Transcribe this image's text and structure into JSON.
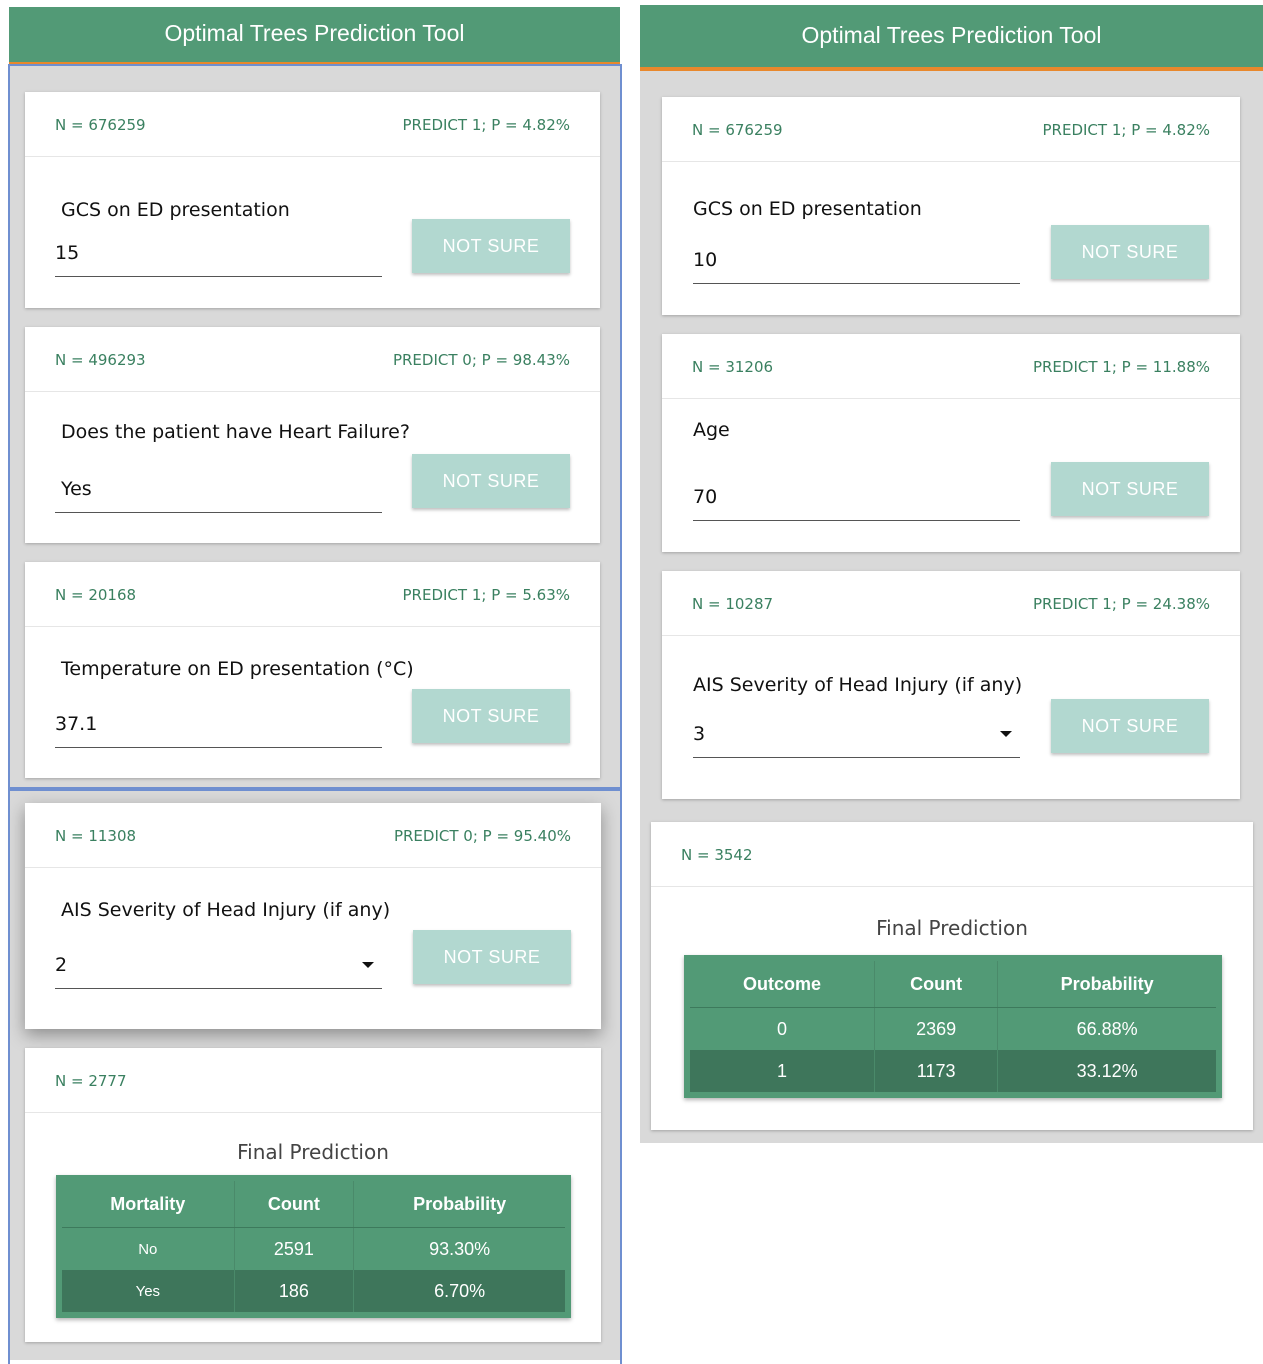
{
  "left": {
    "title": "Optimal Trees Prediction Tool",
    "cards": [
      {
        "n": "N = 676259",
        "predict": "PREDICT 1; P = 4.82%",
        "question": "GCS on ED presentation",
        "value": "15",
        "button": "NOT SURE"
      },
      {
        "n": "N = 496293",
        "predict": "PREDICT 0; P = 98.43%",
        "question": "Does the patient have Heart Failure?",
        "value": "Yes",
        "button": "NOT SURE"
      },
      {
        "n": "N = 20168",
        "predict": "PREDICT 1; P = 5.63%",
        "question": "Temperature on ED presentation (°C)",
        "value": "37.1",
        "button": "NOT SURE"
      },
      {
        "n": "N = 11308",
        "predict": "PREDICT 0; P = 95.40%",
        "question": "AIS Severity of Head Injury (if any)",
        "value": "2",
        "button": "NOT SURE"
      }
    ],
    "final": {
      "n": "N = 2777",
      "title": "Final Prediction",
      "headers": [
        "Mortality",
        "Count",
        "Probability"
      ],
      "rows": [
        [
          "No",
          "2591",
          "93.30%"
        ],
        [
          "Yes",
          "186",
          "6.70%"
        ]
      ]
    }
  },
  "right": {
    "title": "Optimal Trees Prediction Tool",
    "cards": [
      {
        "n": "N = 676259",
        "predict": "PREDICT 1; P = 4.82%",
        "question": "GCS on ED presentation",
        "value": "10",
        "button": "NOT SURE"
      },
      {
        "n": "N = 31206",
        "predict": "PREDICT 1; P = 11.88%",
        "question": "Age",
        "value": "70",
        "button": "NOT SURE"
      },
      {
        "n": "N = 10287",
        "predict": "PREDICT 1; P = 24.38%",
        "question": "AIS Severity of Head Injury (if any)",
        "value": "3",
        "button": "NOT SURE"
      }
    ],
    "final": {
      "n": "N = 3542",
      "title": "Final Prediction",
      "headers": [
        "Outcome",
        "Count",
        "Probability"
      ],
      "rows": [
        [
          "0",
          "2369",
          "66.88%"
        ],
        [
          "1",
          "1173",
          "33.12%"
        ]
      ]
    }
  },
  "colors": {
    "header": "#529a76",
    "accent_line": "#e8882c",
    "button": "#b2d8d0",
    "text_green": "#3a8060"
  }
}
